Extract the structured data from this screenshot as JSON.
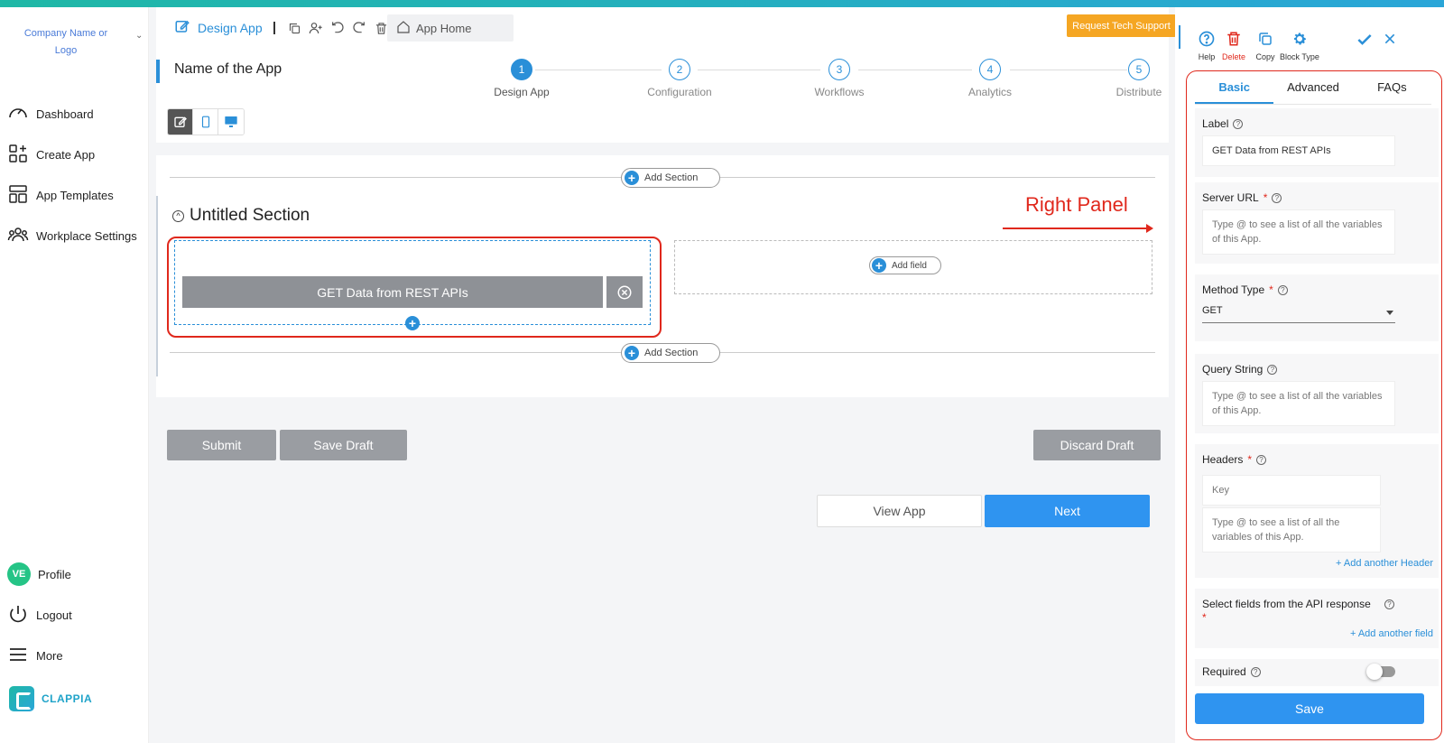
{
  "colors": {
    "accent": "#2a8fd8",
    "support": "#f5a623",
    "highlight": "#e0281c",
    "avatar": "#25c486"
  },
  "sidebar": {
    "company": "Company Name or Logo",
    "items": [
      {
        "label": "Dashboard",
        "icon": "gauge-icon"
      },
      {
        "label": "Create App",
        "icon": "create-app-icon"
      },
      {
        "label": "App Templates",
        "icon": "templates-icon"
      },
      {
        "label": "Workplace Settings",
        "icon": "people-icon"
      }
    ],
    "bottom": {
      "avatar_initials": "VE",
      "profile": "Profile",
      "logout": "Logout",
      "more": "More"
    },
    "brand": "CLAPPIA"
  },
  "header": {
    "design_app": "Design App",
    "app_home": "App Home",
    "support": "Request Tech Support",
    "app_name": "Name of the App"
  },
  "stepper": [
    {
      "num": "1",
      "label": "Design App"
    },
    {
      "num": "2",
      "label": "Configuration"
    },
    {
      "num": "3",
      "label": "Workflows"
    },
    {
      "num": "4",
      "label": "Analytics"
    },
    {
      "num": "5",
      "label": "Distribute"
    }
  ],
  "canvas": {
    "add_section": "Add Section",
    "section_title": "Untitled Section",
    "annotation": "Right Panel",
    "block_label": "GET Data from REST APIs",
    "add_field": "Add field"
  },
  "actions": {
    "submit": "Submit",
    "save_draft": "Save Draft",
    "discard_draft": "Discard Draft",
    "view_app": "View App",
    "next": "Next"
  },
  "rpanel": {
    "tools": [
      "Help",
      "Delete",
      "Copy",
      "Block Type"
    ],
    "tabs": [
      "Basic",
      "Advanced",
      "FAQs"
    ],
    "label_title": "Label",
    "label_value": "GET Data from REST APIs",
    "server_url_title": "Server URL",
    "server_url_ph": "Type @ to see a list of all the variables of this App.",
    "method_title": "Method Type",
    "method_value": "GET",
    "query_title": "Query String",
    "query_ph": "Type @ to see a list of all the variables of this App.",
    "headers_title": "Headers",
    "headers_key_ph": "Key",
    "headers_val_ph": "Type @ to see a list of all the variables of this App.",
    "add_header": "+ Add another Header",
    "select_fields_title": "Select fields from the API response",
    "add_field": "+ Add another field",
    "required_title": "Required",
    "save": "Save"
  }
}
